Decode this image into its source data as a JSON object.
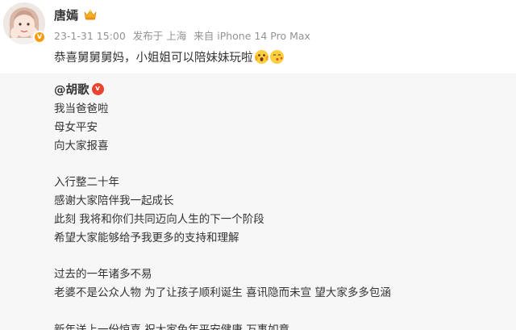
{
  "post": {
    "user_name": "唐嫣",
    "date": "23-1-31 15:00",
    "location": "发布于 上海",
    "source": "来自 iPhone 14 Pro Max",
    "text": "恭喜舅舅舅妈，小姐姐可以陪妹妹玩啦",
    "verified_mark": "v"
  },
  "repost": {
    "author": "@胡歌",
    "verified_mark": "v",
    "paragraphs": [
      [
        "我当爸爸啦",
        "母女平安",
        "向大家报喜"
      ],
      [
        "入行整二十年",
        "感谢大家陪伴我一起成长",
        "此刻 我将和你们共同迈向人生的下一个阶段",
        "希望大家能够给予我更多的支持和理解"
      ],
      [
        "过去的一年诸多不易",
        "老婆不是公众人物 为了让孩子顺利诞生 喜讯隐而未宣 望大家多多包涵"
      ],
      [
        "新年送上一份惊喜 祝大家兔年平安健康 万事如意"
      ]
    ]
  },
  "colors": {
    "meta": "#939393",
    "repost_bg": "#f7f7f7",
    "verified_orange": "#f79a0c",
    "verified_red": "#e8442f"
  }
}
